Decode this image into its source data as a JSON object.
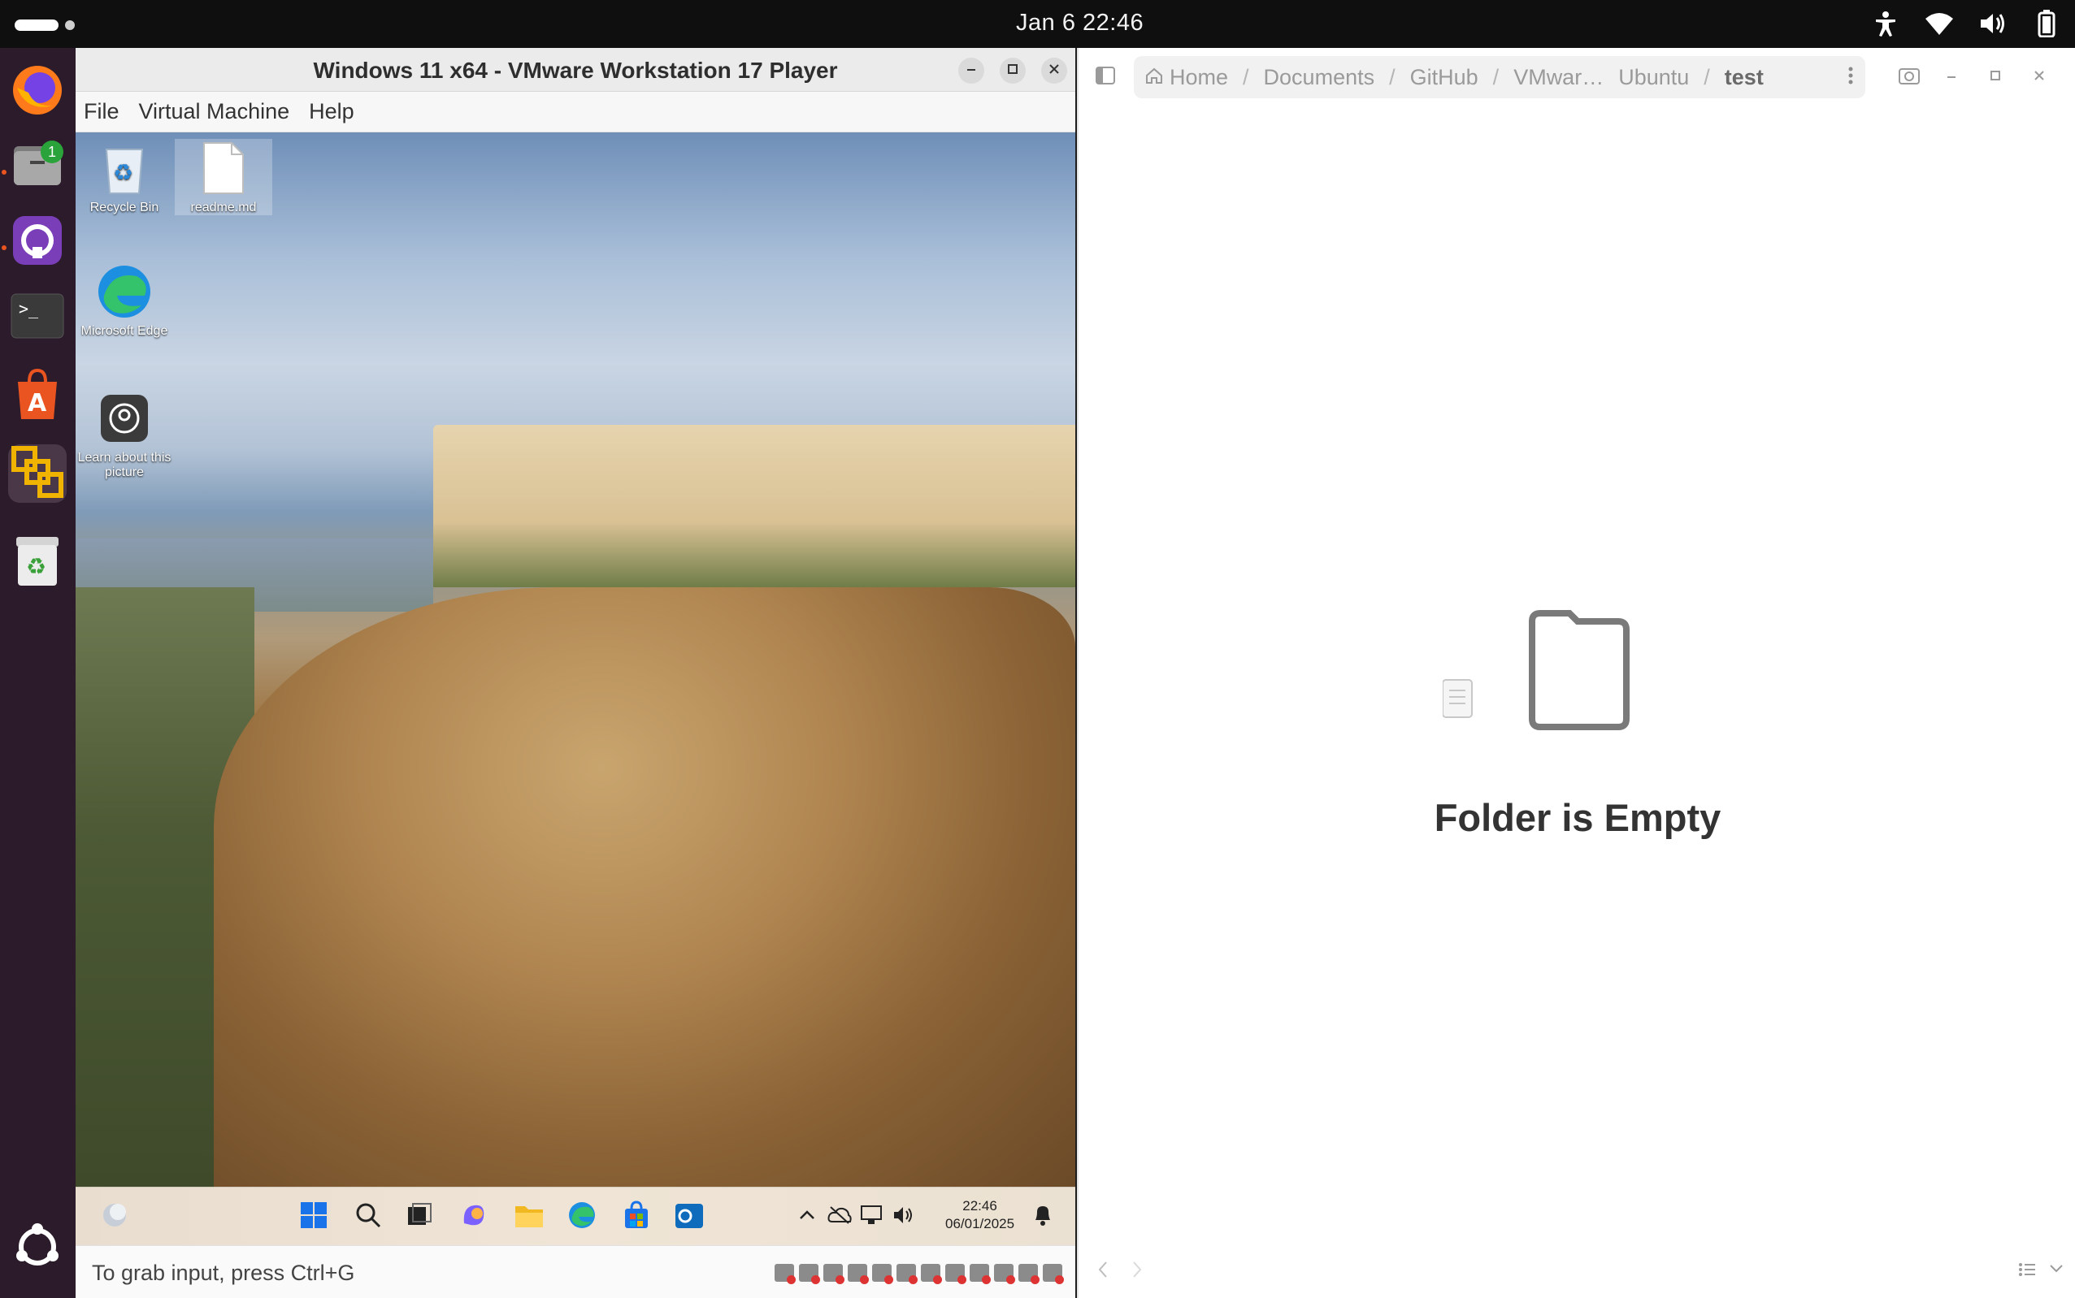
{
  "topbar": {
    "clock": "Jan 6  22:46",
    "status_icons": [
      "accessibility-icon",
      "wifi-icon",
      "volume-icon",
      "battery-icon"
    ]
  },
  "dock": {
    "apps": [
      {
        "name": "firefox",
        "icon": "firefox-icon"
      },
      {
        "name": "files",
        "icon": "files-icon",
        "badge": "1"
      },
      {
        "name": "github-desktop",
        "icon": "github-icon"
      },
      {
        "name": "terminal",
        "icon": "terminal-icon"
      },
      {
        "name": "app-center",
        "icon": "app-center-icon"
      },
      {
        "name": "vmware",
        "icon": "vmware-icon"
      },
      {
        "name": "trash",
        "icon": "trash-icon"
      },
      {
        "name": "show-apps",
        "icon": "ubuntu-icon"
      }
    ]
  },
  "vmware": {
    "title": "Windows 11 x64 - VMware Workstation 17 Player",
    "menu": [
      "File",
      "Virtual Machine",
      "Help"
    ],
    "desktop_icons": [
      {
        "label": "Recycle Bin",
        "icon": "recycle-bin-icon"
      },
      {
        "label": "readme.md",
        "icon": "file-icon"
      },
      {
        "label": "Microsoft Edge",
        "icon": "edge-icon"
      },
      {
        "label": "Learn about this picture",
        "icon": "camera-icon"
      }
    ],
    "taskbar": {
      "time": "22:46",
      "date": "06/01/2025"
    },
    "status_text": "To grab input, press Ctrl+G"
  },
  "files": {
    "breadcrumbs": [
      "Home",
      "Documents",
      "GitHub",
      "VMwar…",
      "Ubuntu",
      "test"
    ],
    "empty_message": "Folder is Empty"
  },
  "colors": {
    "topbar": "#0f0f0f",
    "dock": "#2c1b2a",
    "accent": "#e95420"
  }
}
